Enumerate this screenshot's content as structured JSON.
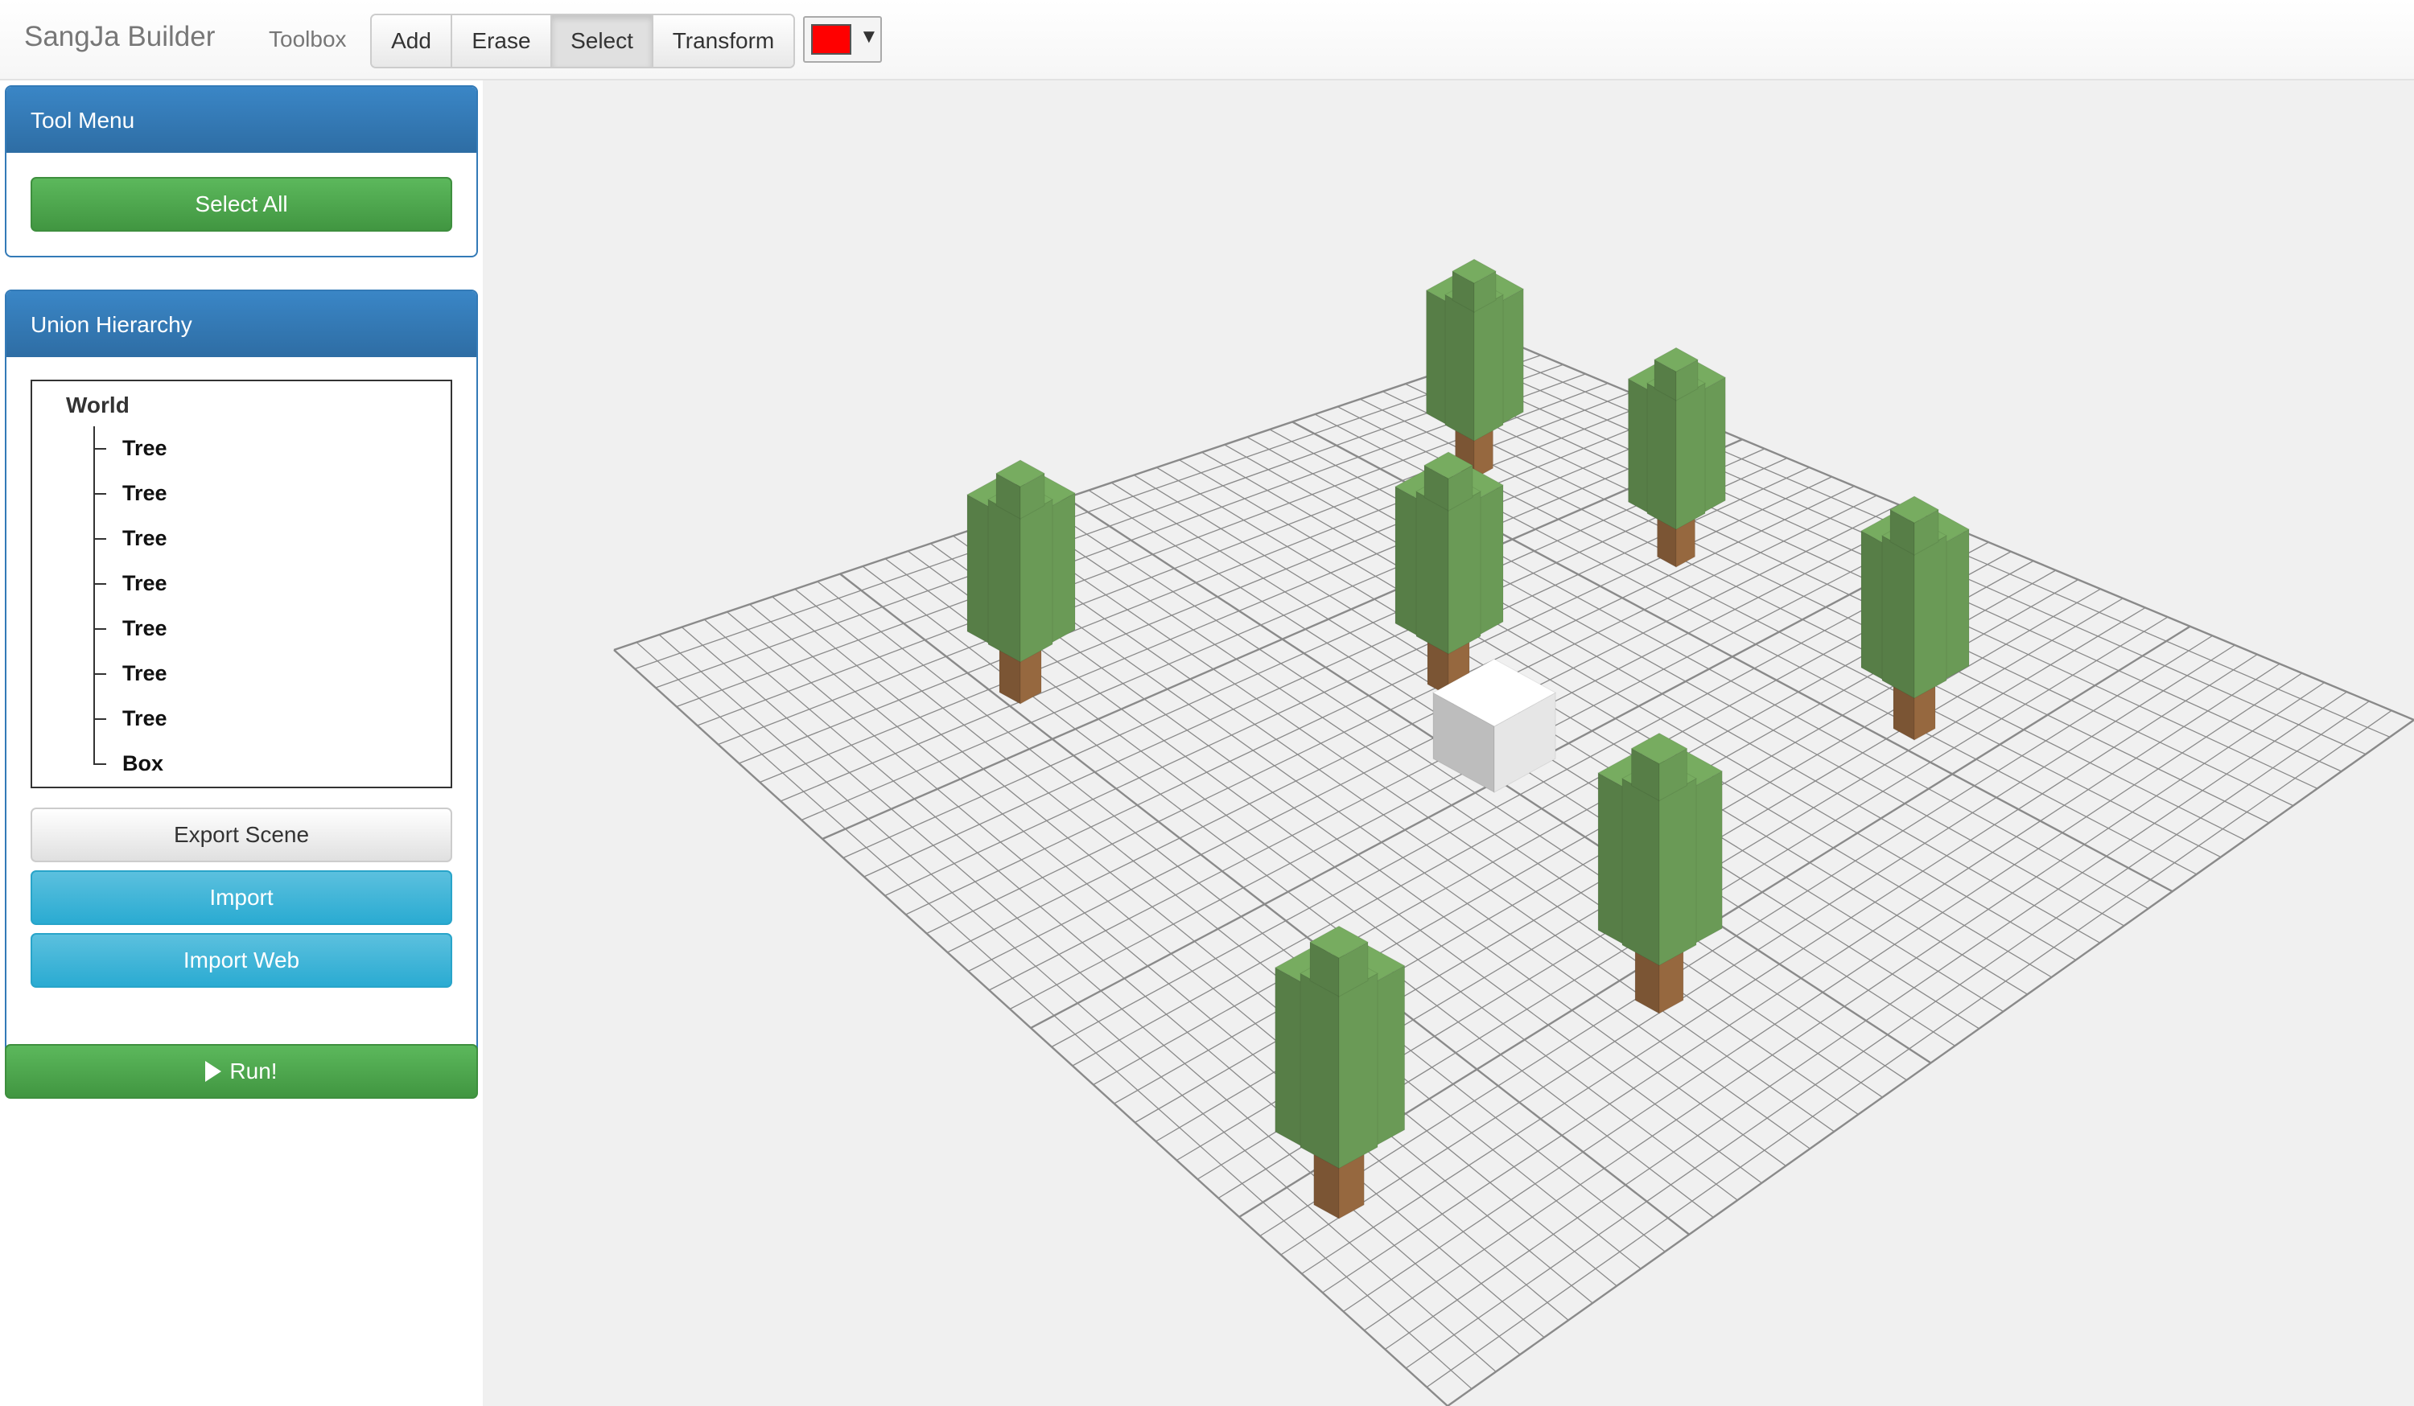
{
  "app": {
    "title": "SangJa Builder"
  },
  "toolbar": {
    "label": "Toolbox",
    "tools": [
      {
        "label": "Add",
        "active": false
      },
      {
        "label": "Erase",
        "active": false
      },
      {
        "label": "Select",
        "active": true
      },
      {
        "label": "Transform",
        "active": false
      }
    ],
    "color": "#ff0000",
    "color_picker_icon": "chevron-down-icon"
  },
  "sidebar": {
    "tool_menu": {
      "title": "Tool Menu",
      "select_all_label": "Select All"
    },
    "hierarchy": {
      "title": "Union Hierarchy",
      "root": "World",
      "children": [
        "Tree",
        "Tree",
        "Tree",
        "Tree",
        "Tree",
        "Tree",
        "Tree",
        "Box"
      ]
    },
    "export_label": "Export Scene",
    "import_label": "Import",
    "import_web_label": "Import Web",
    "run_label": "Run!",
    "run_icon": "play-icon"
  },
  "scene": {
    "background": "#f0f0f0",
    "grid_color": "#8a8a8a",
    "objects": [
      {
        "type": "tree",
        "leaf_color": "#6a9a56",
        "trunk_color": "#96683f"
      },
      {
        "type": "tree",
        "leaf_color": "#6a9a56",
        "trunk_color": "#96683f"
      },
      {
        "type": "tree",
        "leaf_color": "#6a9a56",
        "trunk_color": "#96683f"
      },
      {
        "type": "tree",
        "leaf_color": "#6a9a56",
        "trunk_color": "#96683f"
      },
      {
        "type": "tree",
        "leaf_color": "#6a9a56",
        "trunk_color": "#96683f"
      },
      {
        "type": "tree",
        "leaf_color": "#6a9a56",
        "trunk_color": "#96683f"
      },
      {
        "type": "tree",
        "leaf_color": "#6a9a56",
        "trunk_color": "#96683f"
      },
      {
        "type": "box",
        "color": "#e6e6e6"
      }
    ]
  }
}
